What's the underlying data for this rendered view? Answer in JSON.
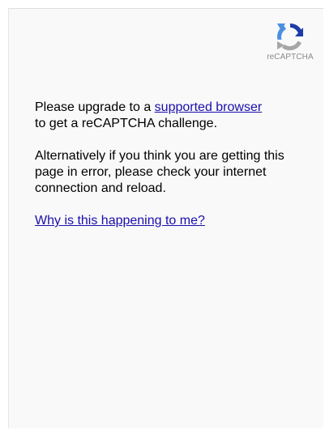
{
  "branding": {
    "logo_text": "reCAPTCHA",
    "icon": "recaptcha-logo-icon"
  },
  "message": {
    "upgrade_prefix": "Please upgrade to a ",
    "supported_browser_link": "supported browser",
    "upgrade_suffix": "to get a reCAPTCHA challenge.",
    "alternative_text": "Alternatively if you think you are getting this page in error, please check your internet connection and reload.",
    "why_link": "Why is this happening to me?"
  },
  "colors": {
    "link": "#1a0dab",
    "background": "#f9f9f9",
    "logo_blue": "#4a90e2",
    "logo_dark_blue": "#1c3aa9",
    "logo_gray": "#a6a6a6"
  }
}
